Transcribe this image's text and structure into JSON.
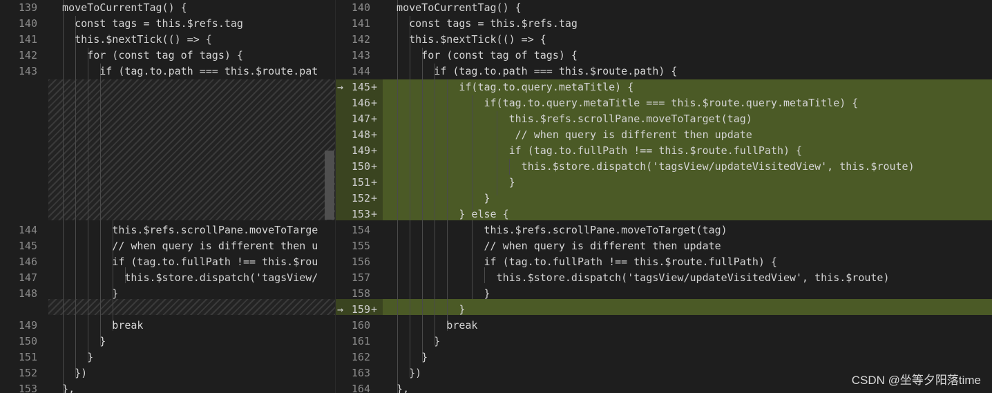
{
  "left": {
    "lines": [
      {
        "ln": "139",
        "code": "  moveToCurrentTag() {"
      },
      {
        "ln": "140",
        "code": "    const tags = this.$refs.tag"
      },
      {
        "ln": "141",
        "code": "    this.$nextTick(() => {"
      },
      {
        "ln": "142",
        "code": "      for (const tag of tags) {"
      },
      {
        "ln": "143",
        "code": "        if (tag.to.path === this.$route.pat"
      },
      {
        "ln": "144",
        "code": "          this.$refs.scrollPane.moveToTarge"
      },
      {
        "ln": "145",
        "code": "          // when query is different then u"
      },
      {
        "ln": "146",
        "code": "          if (tag.to.fullPath !== this.$rou"
      },
      {
        "ln": "147",
        "code": "            this.$store.dispatch('tagsView/"
      },
      {
        "ln": "148",
        "code": "          }"
      },
      {
        "ln": "149",
        "code": "          break"
      },
      {
        "ln": "150",
        "code": "        }"
      },
      {
        "ln": "151",
        "code": "      }"
      },
      {
        "ln": "152",
        "code": "    })"
      },
      {
        "ln": "153",
        "code": "  },"
      }
    ]
  },
  "right": {
    "lines": [
      {
        "ln": "140",
        "code": "  moveToCurrentTag() {"
      },
      {
        "ln": "141",
        "code": "    const tags = this.$refs.tag"
      },
      {
        "ln": "142",
        "code": "    this.$nextTick(() => {"
      },
      {
        "ln": "143",
        "code": "      for (const tag of tags) {"
      },
      {
        "ln": "144",
        "code": "        if (tag.to.path === this.$route.path) {"
      },
      {
        "ln": "145",
        "code": "            if(tag.to.query.metaTitle) {",
        "added": true,
        "arrow": "→"
      },
      {
        "ln": "146",
        "code": "                if(tag.to.query.metaTitle === this.$route.query.metaTitle) {",
        "added": true
      },
      {
        "ln": "147",
        "code": "                    this.$refs.scrollPane.moveToTarget(tag)",
        "added": true
      },
      {
        "ln": "148",
        "code": "                     // when query is different then update",
        "added": true
      },
      {
        "ln": "149",
        "code": "                    if (tag.to.fullPath !== this.$route.fullPath) {",
        "added": true
      },
      {
        "ln": "150",
        "code": "                      this.$store.dispatch('tagsView/updateVisitedView', this.$route)",
        "added": true
      },
      {
        "ln": "151",
        "code": "                    }",
        "added": true
      },
      {
        "ln": "152",
        "code": "                }",
        "added": true
      },
      {
        "ln": "153",
        "code": "            } else {",
        "added": true
      },
      {
        "ln": "154",
        "code": "                this.$refs.scrollPane.moveToTarget(tag)"
      },
      {
        "ln": "155",
        "code": "                // when query is different then update"
      },
      {
        "ln": "156",
        "code": "                if (tag.to.fullPath !== this.$route.fullPath) {"
      },
      {
        "ln": "157",
        "code": "                  this.$store.dispatch('tagsView/updateVisitedView', this.$route)"
      },
      {
        "ln": "158",
        "code": "                }"
      },
      {
        "ln": "159",
        "code": "            }",
        "added": true,
        "arrow": "→"
      },
      {
        "ln": "160",
        "code": "          break"
      },
      {
        "ln": "161",
        "code": "        }"
      },
      {
        "ln": "162",
        "code": "      }"
      },
      {
        "ln": "163",
        "code": "    })"
      },
      {
        "ln": "164",
        "code": "  },"
      }
    ]
  },
  "plus_marker": "+",
  "watermark": "CSDN @坐等夕阳落time",
  "colors": {
    "background": "#1e1e1e",
    "added_line": "#4b5a26",
    "line_number": "#8a8a8a"
  }
}
